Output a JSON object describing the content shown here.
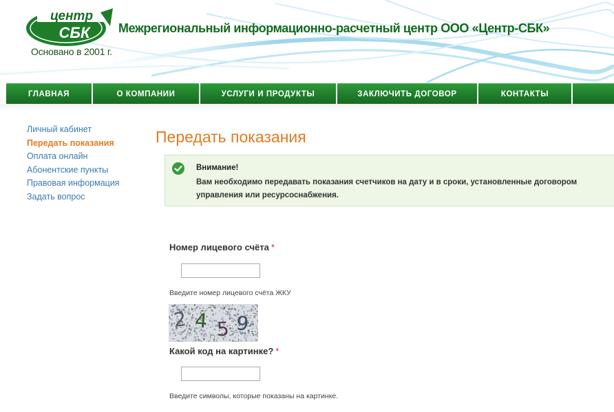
{
  "header": {
    "logo_text": "центр СБК",
    "founded": "Основано в 2001 г.",
    "title": "Межрегиональный информационно-расчетный центр ООО «Центр-СБК»"
  },
  "nav": {
    "items": [
      {
        "label": "ГЛАВНАЯ"
      },
      {
        "label": "О КОМПАНИИ"
      },
      {
        "label": "УСЛУГИ И ПРОДУКТЫ"
      },
      {
        "label": "ЗАКЛЮЧИТЬ ДОГОВОР"
      },
      {
        "label": "КОНТАКТЫ"
      },
      {
        "label": ""
      }
    ]
  },
  "sidebar": {
    "items": [
      {
        "label": "Личный кабинет",
        "active": false
      },
      {
        "label": "Передать показания",
        "active": true
      },
      {
        "label": "Оплата онлайн",
        "active": false
      },
      {
        "label": "Абонентские пункты",
        "active": false
      },
      {
        "label": "Правовая информация",
        "active": false
      },
      {
        "label": "Задать вопрос",
        "active": false
      }
    ]
  },
  "main": {
    "title": "Передать показания",
    "notice": {
      "heading": "Внимание!",
      "text": "Вам необходимо передавать показания счетчиков на дату и в сроки, установленные договором управления или ресурсоснабжения.",
      "icon": "check-circle-icon"
    },
    "form": {
      "account_label": "Номер лицевого счёта",
      "account_required": "*",
      "account_value": "",
      "account_hint": "Введите номер лицевого счёта ЖКУ",
      "captcha_code": "2459",
      "captcha_label": "Какой код на картинке?",
      "captcha_required": "*",
      "captcha_value": "",
      "captcha_hint": "Введите символы, которые показаны на картинке."
    }
  },
  "colors": {
    "brand_green": "#1f7d2a",
    "accent_orange": "#e07b22",
    "link_blue": "#3a7ab0",
    "notice_bg": "#eef7e6"
  }
}
